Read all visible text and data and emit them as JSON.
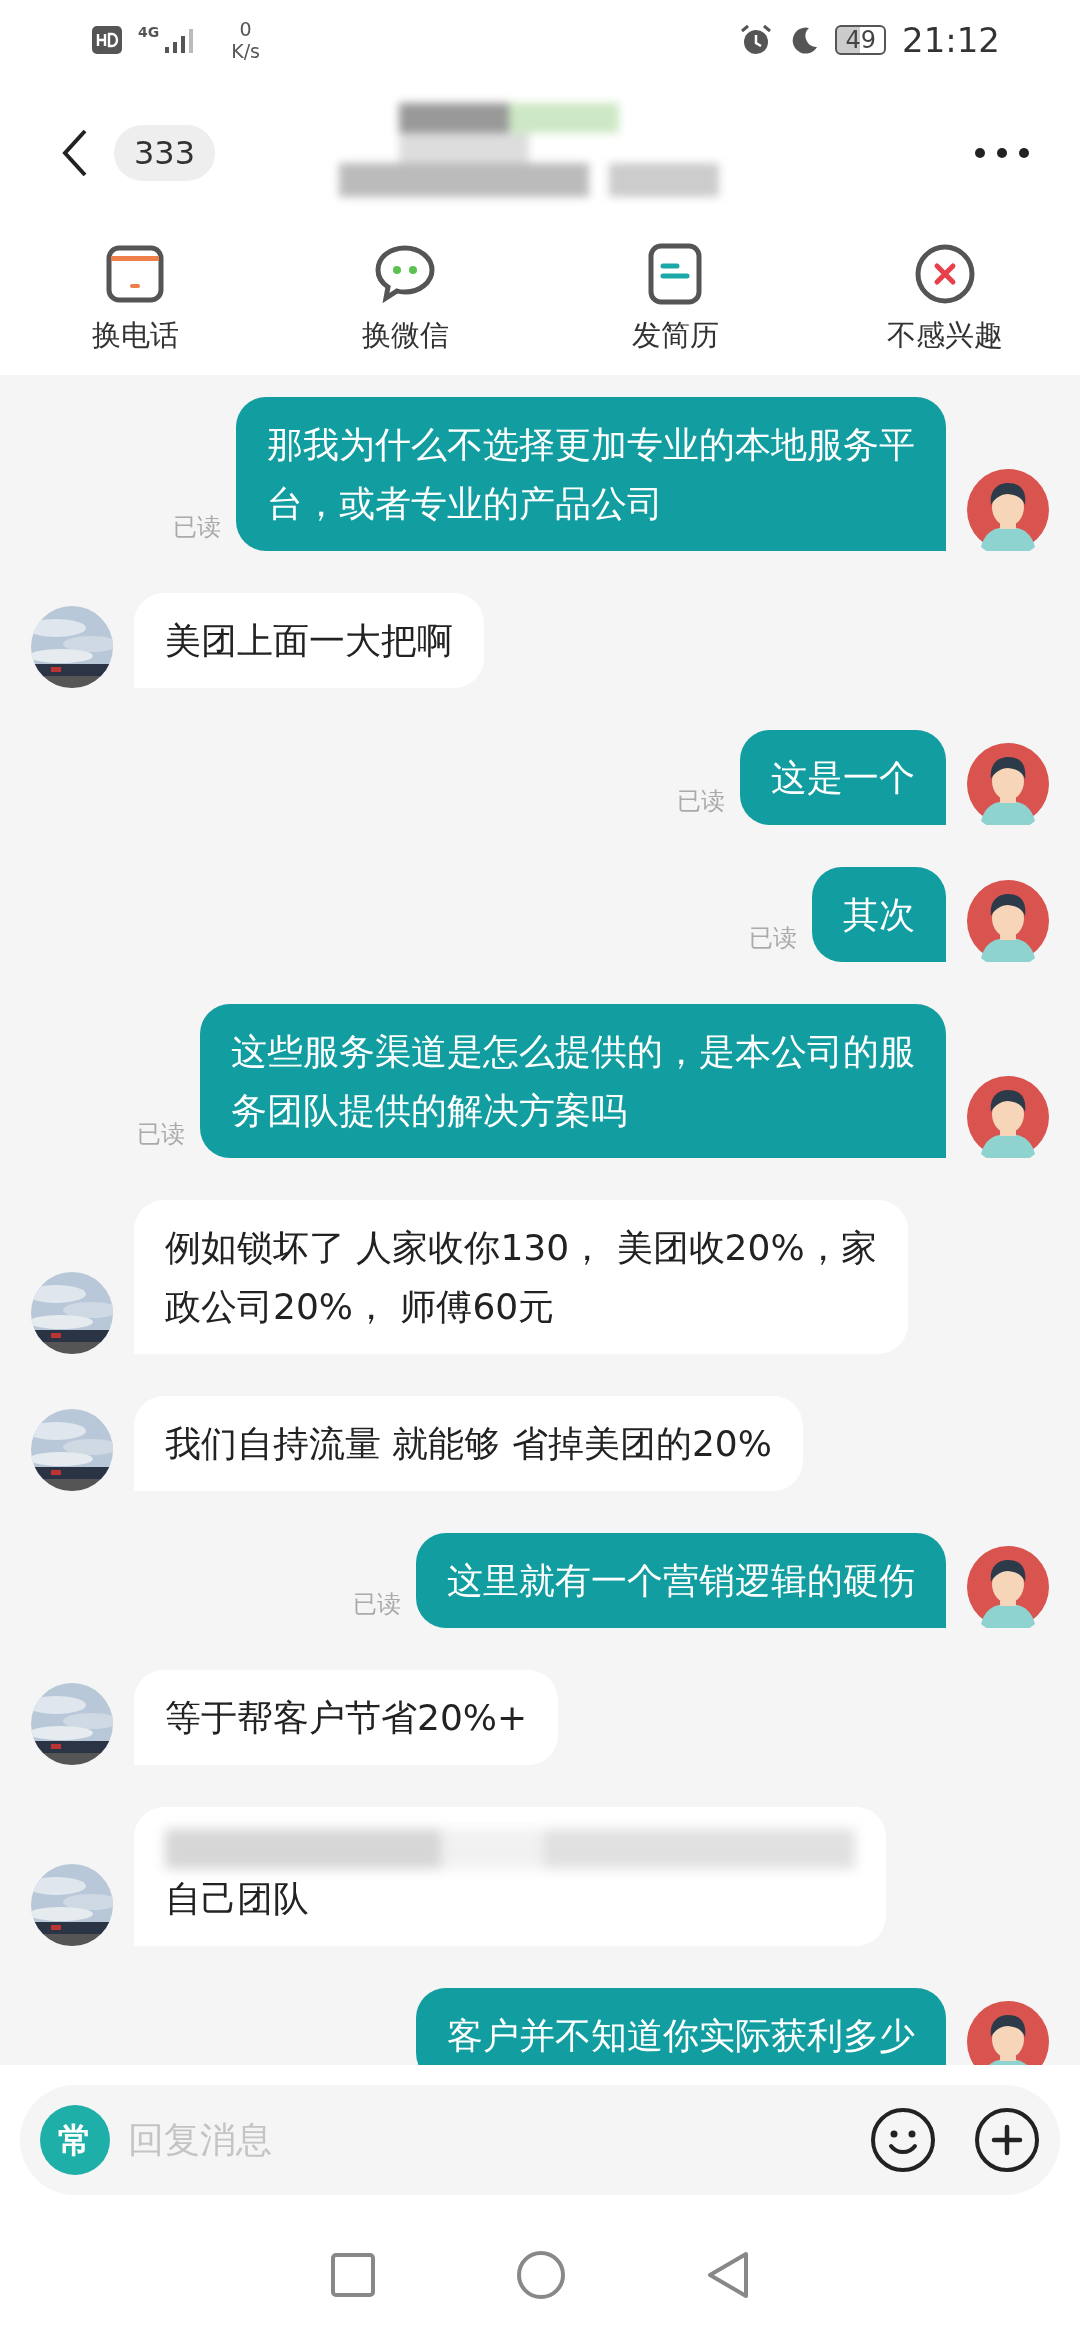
{
  "status_bar": {
    "network": "4G",
    "speed_value": "0",
    "speed_unit": "K/s",
    "battery": "49",
    "time": "21:12"
  },
  "header": {
    "unread_count": "333",
    "title_redacted": true
  },
  "actions": [
    {
      "kind": "phone",
      "label": "换电话"
    },
    {
      "kind": "wechat",
      "label": "换微信"
    },
    {
      "kind": "resume",
      "label": "发简历"
    },
    {
      "kind": "dismiss",
      "label": "不感兴趣"
    }
  ],
  "messages": [
    {
      "kind": "sent",
      "read_label": "已读",
      "lines": [
        "那我为什么不选择更加专业的本地服务平",
        "台，或者专业的产品公司"
      ]
    },
    {
      "kind": "received",
      "lines": [
        "美团上面一大把啊"
      ]
    },
    {
      "kind": "sent",
      "read_label": "已读",
      "lines": [
        "这是一个"
      ]
    },
    {
      "kind": "sent",
      "read_label": "已读",
      "lines": [
        "其次"
      ]
    },
    {
      "kind": "sent",
      "read_label": "已读",
      "lines": [
        "这些服务渠道是怎么提供的，是本公司的服",
        "务团队提供的解决方案吗"
      ]
    },
    {
      "kind": "received",
      "lines": [
        "例如锁坏了  人家收你130， 美团收20%，家",
        "政公司20%， 师傅60元"
      ]
    },
    {
      "kind": "received",
      "lines": [
        "我们自持流量  就能够 省掉美团的20%"
      ]
    },
    {
      "kind": "sent",
      "read_label": "已读",
      "lines": [
        "这里就有一个营销逻辑的硬伤"
      ]
    },
    {
      "kind": "received",
      "lines": [
        "等于帮客户节省20%+"
      ]
    },
    {
      "kind": "received",
      "redacted_line": true,
      "lines": [
        "自己团队"
      ]
    },
    {
      "kind": "sent",
      "lines": [
        "客户并不知道你实际获利多少"
      ]
    }
  ],
  "composer": {
    "quick_reply": "常",
    "placeholder": "回复消息"
  }
}
